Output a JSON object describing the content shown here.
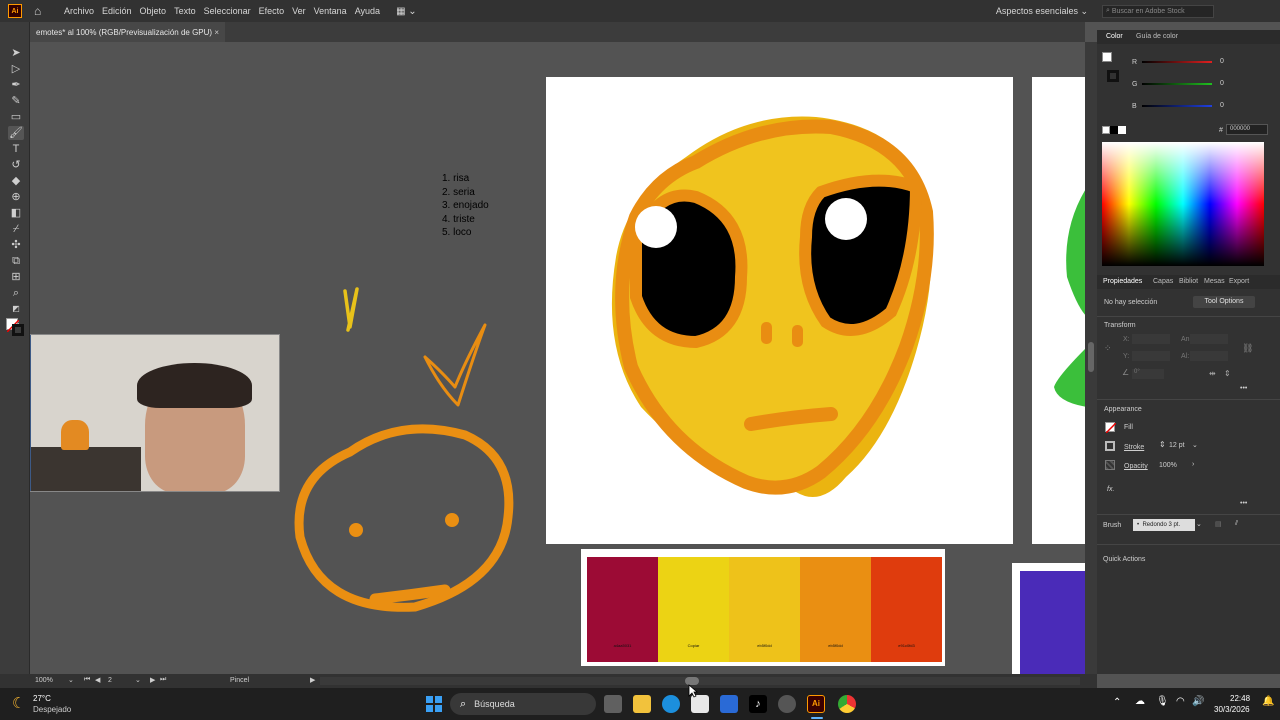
{
  "app": {
    "logo": "Ai",
    "menu": [
      "Archivo",
      "Edición",
      "Objeto",
      "Texto",
      "Seleccionar",
      "Efecto",
      "Ver",
      "Ventana",
      "Ayuda"
    ],
    "workspace": "Aspectos esenciales",
    "stock_search_placeholder": "Buscar en Adobe Stock"
  },
  "document_tab": {
    "title": "emotes* al 100% (RGB/Previsualización de GPU)",
    "close": "×"
  },
  "canvas": {
    "list": [
      "1. risa",
      "2. seria",
      "3. enojado",
      "4. triste",
      "5. loco"
    ],
    "palette": [
      {
        "color": "#9c0b35",
        "label": "a4aa5031"
      },
      {
        "color": "#ecd314",
        "label": "Copiar"
      },
      {
        "color": "#eec21a",
        "label": "eb5f0dd"
      },
      {
        "color": "#ea8f12",
        "label": "eb5f0dd"
      },
      {
        "color": "#df3c0d",
        "label": "e91c0fd3"
      }
    ]
  },
  "color_panel": {
    "tabs": [
      "Color",
      "Guía de color"
    ],
    "channels": [
      {
        "label": "R",
        "value": "0",
        "color": "#e02020"
      },
      {
        "label": "G",
        "value": "0",
        "color": "#20c020"
      },
      {
        "label": "B",
        "value": "0",
        "color": "#2040e0"
      }
    ],
    "hex_label": "#",
    "hex": "000000"
  },
  "properties_panel": {
    "tabs": [
      "Propiedades",
      "Capas",
      "Bibliot",
      "Mesas",
      "Export"
    ],
    "no_selection": "No hay selección",
    "tool_options": "Tool Options",
    "transform": "Transform",
    "x_label": "X:",
    "y_label": "Y:",
    "w_label": "An:",
    "h_label": "Al:",
    "angle": "0°",
    "appearance": "Appearance",
    "fill": "Fill",
    "stroke": "Stroke",
    "stroke_value": "12 pt",
    "opacity": "Opacity",
    "opacity_value": "100%",
    "fx": "fx.",
    "brush_label": "Brush",
    "brush_value": "Redondo 3 pt.",
    "quick_actions": "Quick Actions",
    "more": "•••"
  },
  "statusbar": {
    "zoom": "100%",
    "artboard": "2",
    "tool": "Pincel"
  },
  "taskbar": {
    "weather_temp": "27°C",
    "weather_desc": "Despejado",
    "search": "Búsqueda",
    "time": "22:48",
    "date": "30/3/2026"
  }
}
